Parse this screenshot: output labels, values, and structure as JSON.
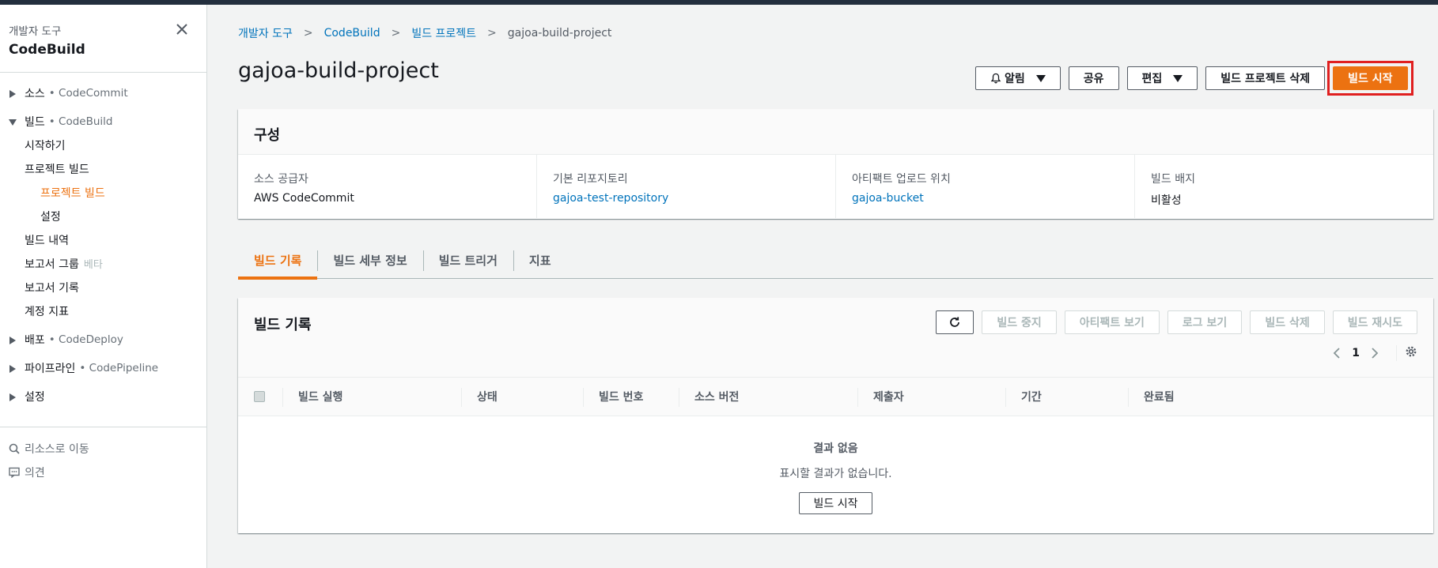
{
  "sidebar": {
    "subtitle": "개발자 도구",
    "title": "CodeBuild",
    "sections": [
      {
        "label": "소스",
        "service": "• CodeCommit"
      },
      {
        "label": "빌드",
        "service": "• CodeBuild"
      },
      {
        "label": "배포",
        "service": "• CodeDeploy"
      },
      {
        "label": "파이프라인",
        "service": "• CodePipeline"
      },
      {
        "label": "설정"
      }
    ],
    "build_items": {
      "getting_started": "시작하기",
      "project_build": "프로젝트 빌드",
      "project_build_sub": "프로젝트 빌드",
      "settings_sub": "설정",
      "build_history": "빌드 내역",
      "report_groups": "보고서 그룹",
      "beta": "베타",
      "report_history": "보고서 기록",
      "account_metrics": "계정 지표"
    },
    "go_to_resource": "리소스로 이동",
    "feedback": "의견"
  },
  "breadcrumb": [
    "개발자 도구",
    "CodeBuild",
    "빌드 프로젝트",
    "gajoa-build-project"
  ],
  "page_title": "gajoa-build-project",
  "actions": {
    "notify": "알림",
    "share": "공유",
    "edit": "편집",
    "delete_project": "빌드 프로젝트 삭제",
    "start_build": "빌드 시작"
  },
  "config": {
    "title": "구성",
    "columns": [
      {
        "key": "소스 공급자",
        "value": "AWS CodeCommit",
        "link": false
      },
      {
        "key": "기본 리포지토리",
        "value": "gajoa-test-repository",
        "link": true
      },
      {
        "key": "아티팩트 업로드 위치",
        "value": "gajoa-bucket",
        "link": true
      },
      {
        "key": "빌드 배지",
        "value": "비활성",
        "link": false
      }
    ]
  },
  "tabs": [
    "빌드 기록",
    "빌드 세부 정보",
    "빌드 트리거",
    "지표"
  ],
  "history": {
    "title": "빌드 기록",
    "actions": {
      "stop": "빌드 중지",
      "view_artifacts": "아티팩트 보기",
      "view_logs": "로그 보기",
      "delete": "빌드 삭제",
      "retry": "빌드 재시도"
    },
    "page": "1",
    "columns": [
      "빌드 실행",
      "상태",
      "빌드 번호",
      "소스 버전",
      "제출자",
      "기간",
      "완료됨"
    ],
    "empty_title": "결과 없음",
    "empty_desc": "표시할 결과가 없습니다.",
    "empty_button": "빌드 시작"
  },
  "colors": {
    "accent": "#ec7211",
    "link": "#0073bb",
    "highlight_box": "#e02020"
  }
}
